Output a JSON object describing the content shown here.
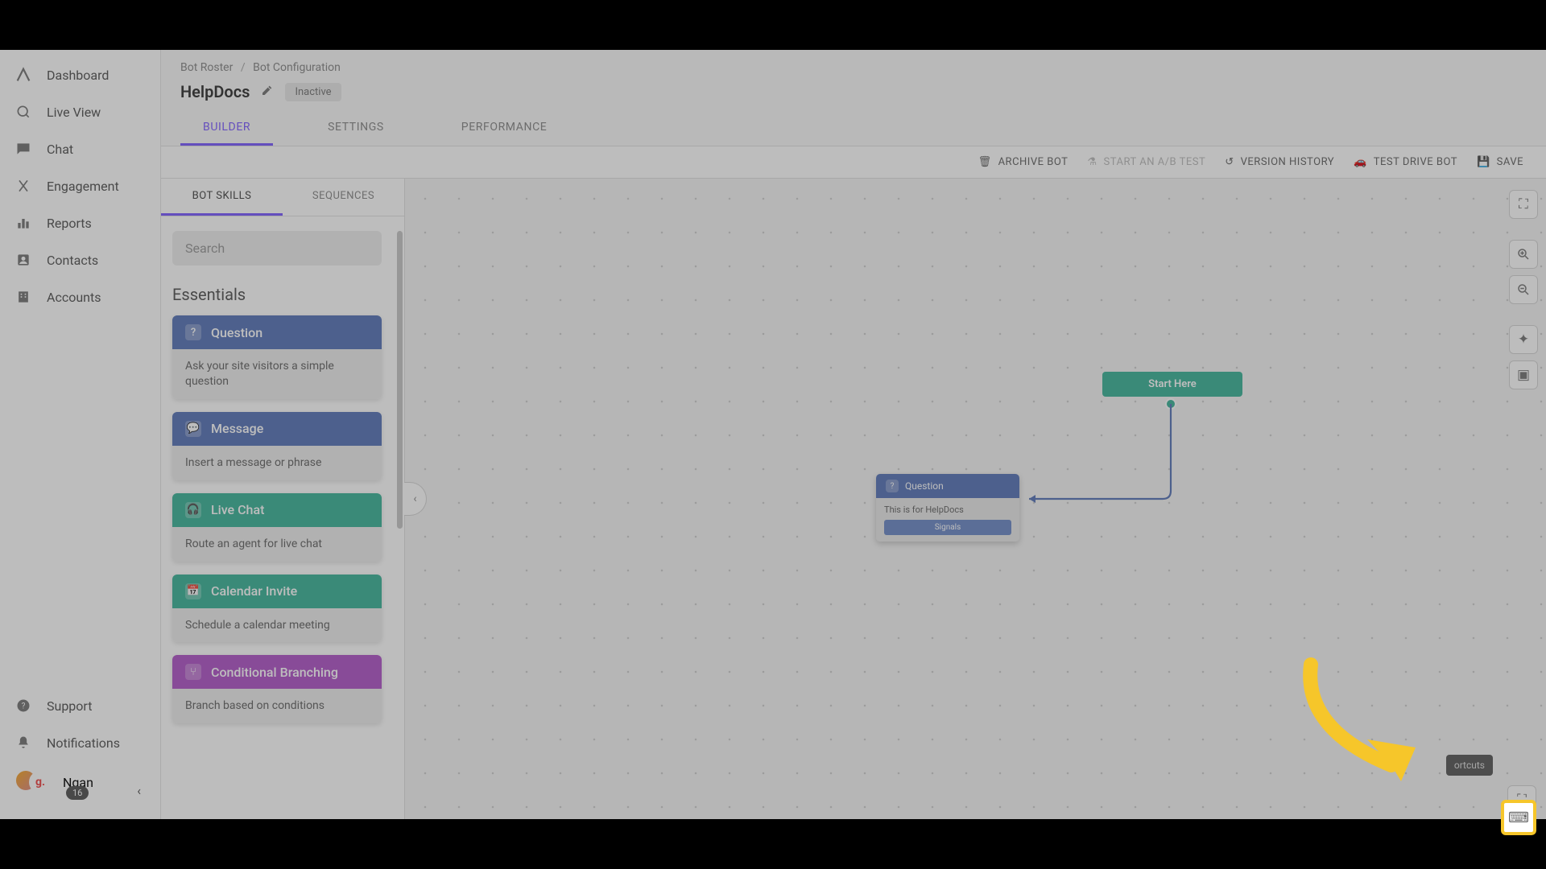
{
  "sidebar": {
    "items": [
      {
        "label": "Dashboard"
      },
      {
        "label": "Live View"
      },
      {
        "label": "Chat"
      },
      {
        "label": "Engagement"
      },
      {
        "label": "Reports"
      },
      {
        "label": "Contacts"
      },
      {
        "label": "Accounts"
      }
    ],
    "footer": [
      {
        "label": "Support"
      },
      {
        "label": "Notifications"
      }
    ],
    "user": {
      "name": "Ngan",
      "avatar_initial": "g.",
      "badge": "16"
    }
  },
  "breadcrumb": {
    "root": "Bot Roster",
    "current": "Bot Configuration"
  },
  "page": {
    "title": "HelpDocs",
    "status": "Inactive"
  },
  "tabs": [
    "BUILDER",
    "SETTINGS",
    "PERFORMANCE"
  ],
  "toolbar": {
    "archive": "ARCHIVE BOT",
    "abtest": "START AN A/B TEST",
    "history": "VERSION HISTORY",
    "testdrive": "TEST DRIVE BOT",
    "save": "SAVE"
  },
  "panel_tabs": [
    "BOT SKILLS",
    "SEQUENCES"
  ],
  "search_placeholder": "Search",
  "section": "Essentials",
  "skills": [
    {
      "title": "Question",
      "desc": "Ask your site visitors a simple question",
      "color": "sk-blue"
    },
    {
      "title": "Message",
      "desc": "Insert a message or phrase",
      "color": "sk-blue"
    },
    {
      "title": "Live Chat",
      "desc": "Route an agent for live chat",
      "color": "sk-green"
    },
    {
      "title": "Calendar Invite",
      "desc": "Schedule a calendar meeting",
      "color": "sk-green"
    },
    {
      "title": "Conditional Branching",
      "desc": "Branch based on conditions",
      "color": "sk-purple"
    }
  ],
  "canvas": {
    "start_label": "Start Here",
    "question_node": {
      "title": "Question",
      "body": "This is for HelpDocs",
      "signals": "Signals"
    },
    "shortcuts_tooltip": "ortcuts"
  }
}
